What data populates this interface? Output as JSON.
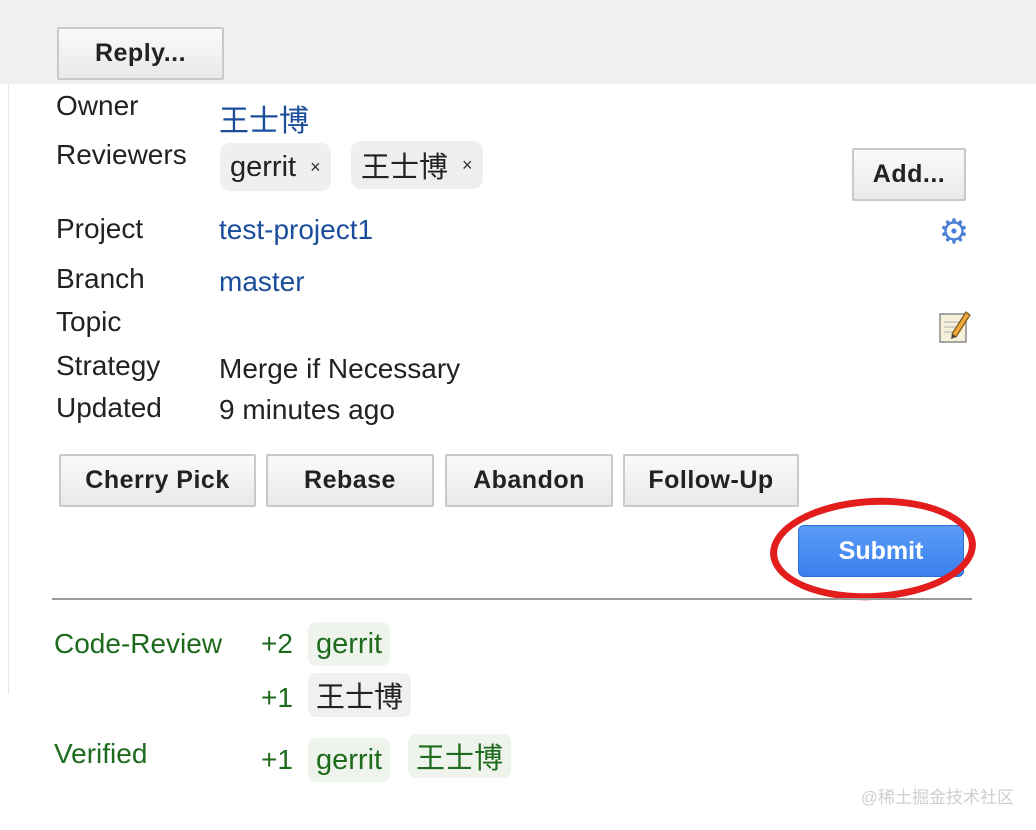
{
  "header": {
    "reply_label": "Reply..."
  },
  "info": {
    "owner_label": "Owner",
    "owner_value": "王士博",
    "reviewers_label": "Reviewers",
    "reviewers": [
      {
        "name": "gerrit",
        "remove": "×"
      },
      {
        "name": "王士博",
        "remove": "×"
      }
    ],
    "add_label": "Add...",
    "project_label": "Project",
    "project_value": "test-project1",
    "branch_label": "Branch",
    "branch_value": "master",
    "topic_label": "Topic",
    "strategy_label": "Strategy",
    "strategy_value": "Merge if Necessary",
    "updated_label": "Updated",
    "updated_value": "9 minutes ago"
  },
  "actions": {
    "cherry_pick": "Cherry Pick",
    "rebase": "Rebase",
    "abandon": "Abandon",
    "follow_up": "Follow-Up",
    "submit": "Submit"
  },
  "votes": {
    "code_review_label": "Code-Review",
    "code_review": [
      {
        "score": "+2",
        "voters": [
          "gerrit"
        ]
      },
      {
        "score": "+1",
        "voters": [
          "王士博"
        ]
      }
    ],
    "verified_label": "Verified",
    "verified": [
      {
        "score": "+1",
        "voters": [
          "gerrit",
          "王士博"
        ]
      }
    ]
  },
  "icons": {
    "project_settings": "gear-icon",
    "topic_edit": "edit-note-icon"
  },
  "colors": {
    "link": "#1a4e9b",
    "submit": "#3b80ee",
    "highlight": "#e31c1c",
    "vote_text": "#1e6b1e"
  },
  "watermark": "@稀土掘金技术社区"
}
